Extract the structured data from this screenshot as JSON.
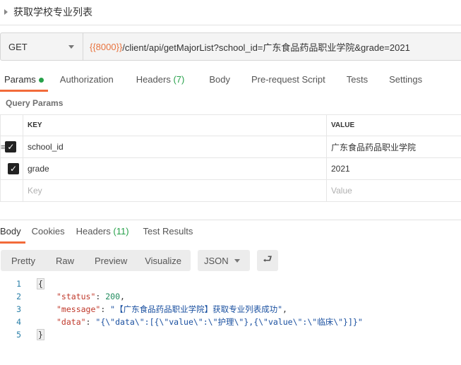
{
  "request": {
    "title": "获取学校专业列表",
    "method": "GET",
    "url_var": "{{8000}}",
    "url_rest": "/client/api/getMajorList?school_id=广东食品药品职业学院&grade=2021"
  },
  "req_tabs": {
    "params": "Params",
    "authorization": "Authorization",
    "headers": "Headers",
    "headers_count": "(7)",
    "body": "Body",
    "prerequest": "Pre-request Script",
    "tests": "Tests",
    "settings": "Settings"
  },
  "query_params": {
    "label": "Query Params",
    "key_header": "KEY",
    "value_header": "VALUE",
    "rows": [
      {
        "key": "school_id",
        "value": "广东食品药品职业学院",
        "checked": true
      },
      {
        "key": "grade",
        "value": "2021",
        "checked": true
      }
    ],
    "key_placeholder": "Key",
    "value_placeholder": "Value"
  },
  "resp_tabs": {
    "body": "Body",
    "cookies": "Cookies",
    "headers": "Headers",
    "headers_count": "(11)",
    "test_results": "Test Results"
  },
  "view": {
    "pretty": "Pretty",
    "raw": "Raw",
    "preview": "Preview",
    "visualize": "Visualize",
    "format": "JSON"
  },
  "response": {
    "lines": [
      "1",
      "2",
      "3",
      "4",
      "5"
    ],
    "open": "{",
    "close": "}",
    "status_key": "\"status\"",
    "status_val": "200",
    "message_key": "\"message\"",
    "message_val": "\"【广东食品药品职业学院】获取专业列表成功\"",
    "data_key": "\"data\"",
    "data_val": "\"{\\\"data\\\":[{\\\"value\\\":\\\"护理\\\"},{\\\"value\\\":\\\"临床\\\"}]}\""
  }
}
